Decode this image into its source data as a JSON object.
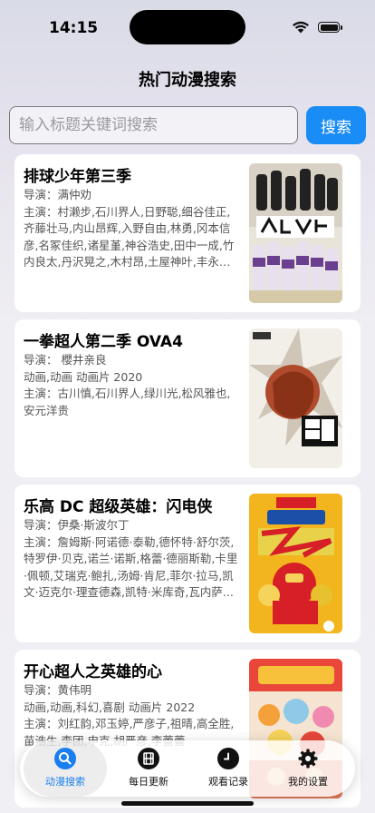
{
  "status": {
    "time": "14:15"
  },
  "page": {
    "title": "热门动漫搜索"
  },
  "search": {
    "placeholder": "输入标题关键词搜索",
    "button_label": "搜索"
  },
  "results": [
    {
      "title": "排球少年第三季",
      "director": "导演：满仲劝",
      "extra": "",
      "cast": "主演：村濑步,石川界人,日野聪,细谷佳正,齐藤壮马,内山昂辉,入野自由,林勇,冈本信彦,名冢佳织,诸星堇,神谷浩史,田中一成,竹内良太,丹沢晃之,木村昂,土屋神叶,丰永利行,大森..."
    },
    {
      "title": "一拳超人第二季 OVA4",
      "director": "导演：  櫻井亲良",
      "extra": "动画,动画 动画片 2020",
      "cast": "主演：古川慎,石川界人,绿川光,松风雅也,安元洋贵"
    },
    {
      "title": "乐高 DC 超级英雄：闪电侠",
      "director": "导演：伊桑·斯波尔丁",
      "extra": "",
      "cast": "主演：詹姆斯·阿诺德·泰勒,德怀特·舒尔茨,特罗伊·贝克,诺兰·诺斯,格蕾·德丽斯勒,卡里·佩顿,艾瑞克·鲍扎,汤姆·肯尼,菲尔·拉马,凯文·迈克尔·理查德森,凯特·米库奇,瓦内萨..."
    },
    {
      "title": "开心超人之英雄的心",
      "director": "导演：黄伟明",
      "extra": "动画,动画,科幻,喜剧 动画片 2022",
      "cast": "主演：刘红韵,邓玉婷,严彦子,祖晴,高全胜,苗浩生,李团,申克,胡严彦,李蕾蕾"
    }
  ],
  "tabs": [
    {
      "label": "动漫搜索",
      "icon": "search-icon",
      "active": true
    },
    {
      "label": "每日更新",
      "icon": "film-icon",
      "active": false
    },
    {
      "label": "观看记录",
      "icon": "clock-icon",
      "active": false
    },
    {
      "label": "我的设置",
      "icon": "gear-icon",
      "active": false
    }
  ],
  "colors": {
    "accent": "#1a8cf6",
    "tab_active": "#1a7ef0"
  }
}
